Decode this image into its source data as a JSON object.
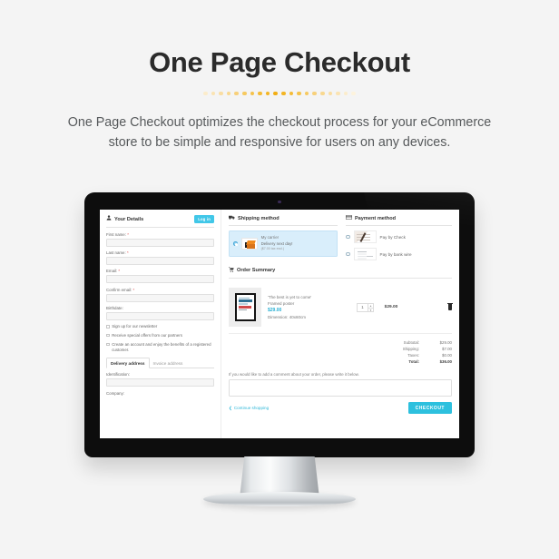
{
  "hero": {
    "title": "One Page Checkout",
    "subtitle": "One Page Checkout optimizes the checkout process for your eCommerce store to be simple and responsive for users on any devices.",
    "divider_colors": [
      "#fbeccb",
      "#fae3b2",
      "#f9dda2",
      "#f8d88f",
      "#f7d07a",
      "#f6c95f",
      "#f5c24a",
      "#f4bb35",
      "#f3b524",
      "#f2ae14",
      "#f3b524",
      "#f4bb35",
      "#f5c24a",
      "#f6c95f",
      "#f7d07a",
      "#f8d88f",
      "#f9dda2",
      "#fae3b2",
      "#fbeccb",
      "#fdf3dd"
    ]
  },
  "colors": {
    "accent_cyan": "#2dc0de",
    "accent_orange": "#f2ae14",
    "page_bg": "#f4f4f4",
    "bezel": "#0d0d0d",
    "carrier_highlight": "#d9eefb"
  },
  "details_panel": {
    "icon": "user-icon",
    "title": "Your Details",
    "login_button": "Log in",
    "fields": [
      {
        "label": "First name:",
        "required": true,
        "value": ""
      },
      {
        "label": "Last name:",
        "required": true,
        "value": ""
      },
      {
        "label": "Email:",
        "required": true,
        "value": ""
      },
      {
        "label": "Confirm email:",
        "required": true,
        "value": ""
      },
      {
        "label": "Birthdate:",
        "required": false,
        "value": ""
      }
    ],
    "checkboxes": [
      {
        "label": "Sign up for our newsletter",
        "checked": false
      },
      {
        "label": "Receive special offers from our partners",
        "checked": false
      },
      {
        "label": "Create an account and enjoy the benefits of a registered customer.",
        "checked": false
      }
    ],
    "address_tabs": [
      {
        "label": "Delivery address",
        "active": true
      },
      {
        "label": "Invoice address",
        "active": false
      }
    ],
    "address_fields": [
      {
        "label": "Identification:",
        "value": ""
      },
      {
        "label": "Company:",
        "value": ""
      }
    ]
  },
  "shipping_panel": {
    "icon": "truck-icon",
    "title": "Shipping method",
    "carrier": {
      "selected": true,
      "name": "My carrier",
      "delivery": "Delivery next day!",
      "price_note": "($7.00 tax excl.)",
      "image": "package-box-icon"
    }
  },
  "payment_panel": {
    "icon": "card-icon",
    "title": "Payment method",
    "options": [
      {
        "label": "Pay by Check",
        "selected": false,
        "image": "check-pen-image"
      },
      {
        "label": "Pay by bank wire",
        "selected": false,
        "image": "bank-wire-image"
      }
    ]
  },
  "order_summary": {
    "icon": "cart-icon",
    "title": "Order Summary",
    "item": {
      "name": "'The best is yet to come'",
      "type": "Framed poster",
      "unit_price": "$29.00",
      "dimension": "Dimension: 40x60cm",
      "quantity": "1",
      "line_total": "$29.00",
      "remove_icon": "trash-icon",
      "image": "framed-poster-thumbnail"
    },
    "totals": [
      {
        "label": "Subtotal:",
        "value": "$29.00",
        "grand": false
      },
      {
        "label": "Shipping:",
        "value": "$7.00",
        "grand": false
      },
      {
        "label": "Taxes:",
        "value": "$0.00",
        "grand": false
      },
      {
        "label": "Total:",
        "value": "$36.00",
        "grand": true
      }
    ],
    "comment_note": "If you would like to add a comment about your order, please write it below.",
    "comment_value": "",
    "continue_link": "Continue shopping",
    "checkout_button": "CHECKOUT"
  },
  "device": {
    "type": "imac-desktop-monitor",
    "webcam": "webcam-dot"
  }
}
